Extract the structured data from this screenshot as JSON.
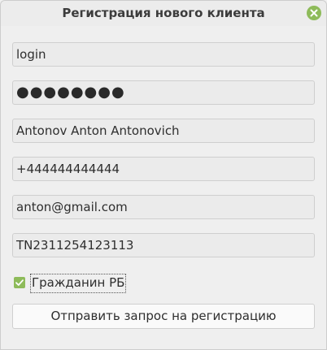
{
  "window": {
    "title": "Регистрация нового клиента"
  },
  "icons": {
    "close": "close-icon",
    "checkbox": "check-icon"
  },
  "form": {
    "login": "login",
    "password_mask": "●●●●●●●●",
    "full_name": "Antonov Anton Antonovich",
    "phone": "+444444444444",
    "email": "anton@gmail.com",
    "passport": "TN2311254123113",
    "citizen_label": "Гражданин РБ",
    "citizen_checked": true,
    "submit_label": "Отправить запрос на регистрацию"
  },
  "colors": {
    "accent": "#8ebb5a",
    "background": "#efefef",
    "field_bg": "#ebebeb",
    "field_border": "#cfcfcf"
  }
}
